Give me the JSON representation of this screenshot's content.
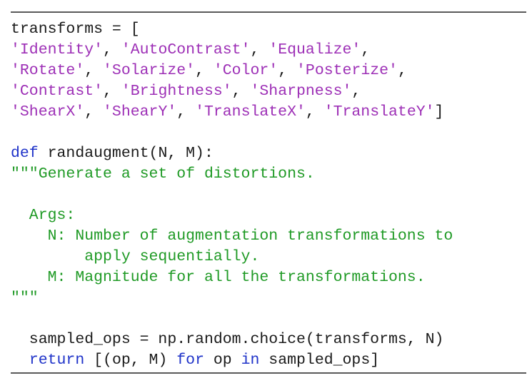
{
  "code_listing": {
    "colors": {
      "plain": "#1a1a1a",
      "string": "#9d2fb6",
      "keyword": "#1f33c9",
      "docstring": "#1f9a25",
      "rule": "#5a5a5a"
    },
    "lines": [
      [
        {
          "t": "plain",
          "v": "transforms = ["
        }
      ],
      [
        {
          "t": "string",
          "v": "'Identity'"
        },
        {
          "t": "plain",
          "v": ", "
        },
        {
          "t": "string",
          "v": "'AutoContrast'"
        },
        {
          "t": "plain",
          "v": ", "
        },
        {
          "t": "string",
          "v": "'Equalize'"
        },
        {
          "t": "plain",
          "v": ","
        }
      ],
      [
        {
          "t": "string",
          "v": "'Rotate'"
        },
        {
          "t": "plain",
          "v": ", "
        },
        {
          "t": "string",
          "v": "'Solarize'"
        },
        {
          "t": "plain",
          "v": ", "
        },
        {
          "t": "string",
          "v": "'Color'"
        },
        {
          "t": "plain",
          "v": ", "
        },
        {
          "t": "string",
          "v": "'Posterize'"
        },
        {
          "t": "plain",
          "v": ","
        }
      ],
      [
        {
          "t": "string",
          "v": "'Contrast'"
        },
        {
          "t": "plain",
          "v": ", "
        },
        {
          "t": "string",
          "v": "'Brightness'"
        },
        {
          "t": "plain",
          "v": ", "
        },
        {
          "t": "string",
          "v": "'Sharpness'"
        },
        {
          "t": "plain",
          "v": ","
        }
      ],
      [
        {
          "t": "string",
          "v": "'ShearX'"
        },
        {
          "t": "plain",
          "v": ", "
        },
        {
          "t": "string",
          "v": "'ShearY'"
        },
        {
          "t": "plain",
          "v": ", "
        },
        {
          "t": "string",
          "v": "'TranslateX'"
        },
        {
          "t": "plain",
          "v": ", "
        },
        {
          "t": "string",
          "v": "'TranslateY'"
        },
        {
          "t": "plain",
          "v": "]"
        }
      ],
      [],
      [
        {
          "t": "keyword",
          "v": "def"
        },
        {
          "t": "plain",
          "v": " randaugment(N, M):"
        }
      ],
      [
        {
          "t": "comment",
          "v": "\"\"\"Generate a set of distortions."
        }
      ],
      [],
      [
        {
          "t": "comment",
          "v": "  Args:"
        }
      ],
      [
        {
          "t": "comment",
          "v": "    N: Number of augmentation transformations to"
        }
      ],
      [
        {
          "t": "comment",
          "v": "        apply sequentially."
        }
      ],
      [
        {
          "t": "comment",
          "v": "    M: Magnitude for all the transformations."
        }
      ],
      [
        {
          "t": "comment",
          "v": "\"\"\""
        }
      ],
      [],
      [
        {
          "t": "plain",
          "v": "  sampled_ops = np.random.choice(transforms, N)"
        }
      ],
      [
        {
          "t": "plain",
          "v": "  "
        },
        {
          "t": "keyword",
          "v": "return"
        },
        {
          "t": "plain",
          "v": " [(op, M) "
        },
        {
          "t": "keyword",
          "v": "for"
        },
        {
          "t": "plain",
          "v": " op "
        },
        {
          "t": "keyword",
          "v": "in"
        },
        {
          "t": "plain",
          "v": " sampled_ops]"
        }
      ]
    ]
  }
}
